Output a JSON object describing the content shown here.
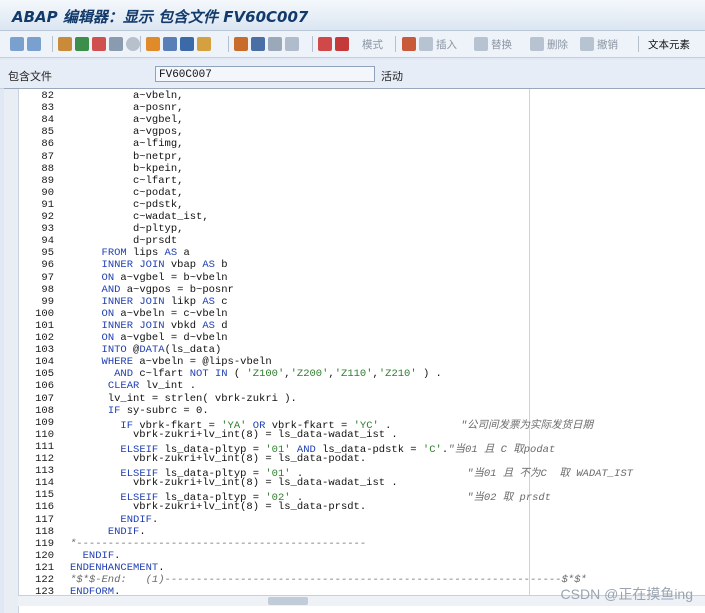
{
  "title": "ABAP 编辑器：显示 包含文件 FV60C007",
  "toolbar": {
    "buttons": [
      {
        "label": "模式"
      },
      {
        "label": "插入"
      },
      {
        "label": "替换"
      },
      {
        "label": "删除"
      },
      {
        "label": "撤销"
      },
      {
        "label": "文本元素"
      }
    ]
  },
  "fields": {
    "include_label": "包含文件",
    "include_value": "FV60C007",
    "status": "活动"
  },
  "watermark": "CSDN @正在摸鱼ing",
  "editor": {
    "lines": [
      {
        "n": "82",
        "c": "          a~vbeln,"
      },
      {
        "n": "83",
        "c": "          a~posnr,"
      },
      {
        "n": "84",
        "c": "          a~vgbel,"
      },
      {
        "n": "85",
        "c": "          a~vgpos,"
      },
      {
        "n": "86",
        "c": "          a~lfimg,"
      },
      {
        "n": "87",
        "c": "          b~netpr,"
      },
      {
        "n": "88",
        "c": "          b~kpein,"
      },
      {
        "n": "89",
        "c": "          c~lfart,"
      },
      {
        "n": "90",
        "c": "          c~podat,"
      },
      {
        "n": "91",
        "c": "          c~pdstk,"
      },
      {
        "n": "92",
        "c": "          c~wadat_ist,"
      },
      {
        "n": "93",
        "c": "          d~pltyp,"
      },
      {
        "n": "94",
        "c": "          d~prsdt"
      },
      {
        "n": "95",
        "c": "     FROM lips AS a"
      },
      {
        "n": "96",
        "c": "     INNER JOIN vbap AS b"
      },
      {
        "n": "97",
        "c": "     ON a~vgbel = b~vbeln"
      },
      {
        "n": "98",
        "c": "     AND a~vgpos = b~posnr"
      },
      {
        "n": "99",
        "c": "     INNER JOIN likp AS c"
      },
      {
        "n": "100",
        "c": "     ON a~vbeln = c~vbeln"
      },
      {
        "n": "101",
        "c": "     INNER JOIN vbkd AS d"
      },
      {
        "n": "102",
        "c": "     ON a~vgbel = d~vbeln"
      },
      {
        "n": "103",
        "c": "     INTO @DATA(ls_data)"
      },
      {
        "n": "104",
        "c": "     WHERE a~vbeln = @lips-vbeln"
      },
      {
        "n": "105",
        "c": "       AND c~lfart NOT IN ( 'Z100','Z200','Z110','Z210' ) ."
      },
      {
        "n": "106",
        "c": "      CLEAR lv_int ."
      },
      {
        "n": "107",
        "c": "      lv_int = strlen( vbrk-zukri )."
      },
      {
        "n": "108",
        "c": "      IF sy-subrc = 0."
      },
      {
        "n": "109",
        "c": "        IF vbrk-fkart = 'YA' OR vbrk-fkart = 'YC' .           \"公司间发票为实际发货日期"
      },
      {
        "n": "110",
        "c": "          vbrk-zukri+lv_int(8) = ls_data-wadat_ist ."
      },
      {
        "n": "111",
        "c": "        ELSEIF ls_data-pltyp = '01' AND ls_data-pdstk = 'C'.\"当01 且 C 取podat"
      },
      {
        "n": "112",
        "c": "          vbrk-zukri+lv_int(8) = ls_data-podat."
      },
      {
        "n": "113",
        "c": "        ELSEIF ls_data-pltyp = '01' .                          \"当01 且 不为C  取 WADAT_IST"
      },
      {
        "n": "114",
        "c": "          vbrk-zukri+lv_int(8) = ls_data-wadat_ist ."
      },
      {
        "n": "115",
        "c": "        ELSEIF ls_data-pltyp = '02' .                          \"当02 取 prsdt"
      },
      {
        "n": "116",
        "c": "          vbrk-zukri+lv_int(8) = ls_data-prsdt."
      },
      {
        "n": "117",
        "c": "        ENDIF."
      },
      {
        "n": "118",
        "c": "      ENDIF."
      },
      {
        "n": "119",
        "c": "*----------------------------------------------"
      },
      {
        "n": "120",
        "c": "  ENDIF."
      },
      {
        "n": "121",
        "c": "ENDENHANCEMENT."
      },
      {
        "n": "122",
        "c": "*$*$-End:   (1)---------------------------------------------------------------$*$*"
      },
      {
        "n": "123",
        "c": "ENDFORM."
      }
    ]
  },
  "colors": {
    "keyword": "#1f3fb3",
    "string": "#2f7e2f",
    "comment": "#6b6b6b",
    "accent": "#123a6b"
  }
}
